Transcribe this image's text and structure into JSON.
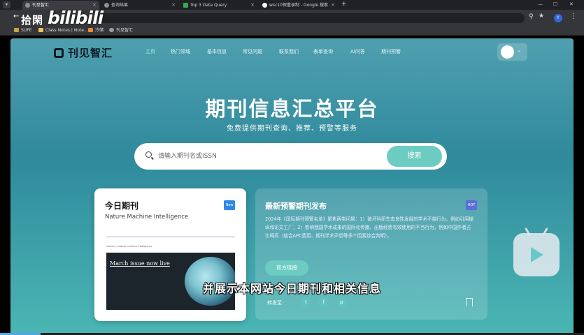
{
  "browser": {
    "tabs": [
      {
        "label": "刊见智汇",
        "active": true
      },
      {
        "label": "查询结果",
        "active": false
      },
      {
        "label": "Top 3 Data Query",
        "active": false
      },
      {
        "label": "wsc10保重录制 - Google 搜索",
        "active": false
      }
    ],
    "bookmarks": [
      "SUFE",
      "Class Notes | Note...",
      "冷储",
      "刊见智汇"
    ],
    "profile_initial": "Y",
    "tab_close": "×",
    "new_tab": "+",
    "window_controls": {
      "minimize": "—",
      "maximize": "☐",
      "close": "✕"
    }
  },
  "overlay": {
    "title": "拾閑",
    "bilibili_logo": "bilibili",
    "subtitle": "并展示本网站今日期刊和相关信息",
    "progress_fraction": 0.07
  },
  "site": {
    "brand": "刊见智汇",
    "nav": [
      "主页",
      "热门领域",
      "基本信息",
      "常见问题",
      "联系我们",
      "表单查询",
      "AI问答",
      "期刊预警"
    ],
    "hero_title": "期刊信息汇总平台",
    "hero_subtitle": "免费提供期刊查询、推荐、预警等服务",
    "search_placeholder": "请输入期刊名或ISSN",
    "search_button": "搜索"
  },
  "today_card": {
    "title": "今日期刊",
    "badge": "New",
    "journal_name": "Nature Machine Intelligence",
    "screenshot_breadcrumb": "nature > nature machine intelligence",
    "screenshot_heading": "March issue now live"
  },
  "warning_card": {
    "title": "最新预警期刊发布",
    "badge": "HOT",
    "body": "2024年《国际期刊预警名单》聚焦两类问题：1）破坏科研生态良性发展的学术不端行为，例如引用操纵和论文工厂；2）影响我国学术成果的国际化传播、出版经费有效使用的不当行为，例如中国作者占比畸高（结合APC费用、期刊学术声望等多个因素综合判断）。",
    "official_link": "官方链接",
    "share_label": "转发至:",
    "share_icons": [
      "twitter-icon",
      "facebook-icon",
      "pinterest-icon"
    ]
  },
  "colors": {
    "accent": "#6dccc2",
    "page_top": "#4f9faf",
    "page_bottom": "#4bb6b4"
  }
}
